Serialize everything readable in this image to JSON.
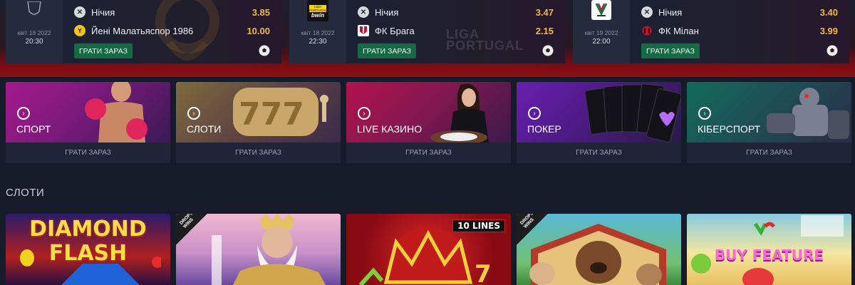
{
  "matches": [
    {
      "date": "квіт 18 2022",
      "time": "20:30",
      "rows": [
        {
          "name": "Нічия",
          "odd": "3.85"
        },
        {
          "name": "Йені Малатьяспор 1986",
          "odd": "10.00"
        }
      ],
      "play_label": "ГРАТИ ЗАРАЗ",
      "logo_icon": "trophy-icon"
    },
    {
      "date": "квіт 18 2022",
      "time": "22:30",
      "rows": [
        {
          "name": "Нічия",
          "odd": "3.47"
        },
        {
          "name": "ФК Брага",
          "odd": "2.15"
        }
      ],
      "play_label": "ГРАТИ ЗАРАЗ",
      "logo_text_top": "LIGA PORTUGAL",
      "logo_text_bottom": "bwin",
      "watermark": "LIGA PORTUGAL"
    },
    {
      "date": "квіт 19 2022",
      "time": "22:00",
      "rows": [
        {
          "name": "Нічия",
          "odd": "3.40"
        },
        {
          "name": "ФК Мілан",
          "odd": "3.99"
        }
      ],
      "play_label": "ГРАТИ ЗАРАЗ",
      "logo_icon": "coppa-italia-icon"
    }
  ],
  "categories": [
    {
      "title": "СПОРТ",
      "play": "ГРАТИ ЗАРАЗ"
    },
    {
      "title": "СЛОТИ",
      "play": "ГРАТИ ЗАРАЗ"
    },
    {
      "title": "LIVE КАЗИНО",
      "play": "ГРАТИ ЗАРАЗ"
    },
    {
      "title": "ПОКЕР",
      "play": "ГРАТИ ЗАРАЗ"
    },
    {
      "title": "КІБЕРСПОРТ",
      "play": "ГРАТИ ЗАРАЗ"
    }
  ],
  "slots_section": {
    "title": "СЛОТИ"
  },
  "slots": [
    {
      "line1": "DIAMOND",
      "line2": "FLASH"
    },
    {
      "badge": "DROPS & WINS"
    },
    {
      "badge": "10 LINES"
    },
    {
      "badge": "DROPS & WINS"
    },
    {
      "line1": "BUY FEATURE"
    }
  ],
  "colors": {
    "odd": "#f6b73c",
    "play_button": "#136b43",
    "background": "#161b2a"
  }
}
